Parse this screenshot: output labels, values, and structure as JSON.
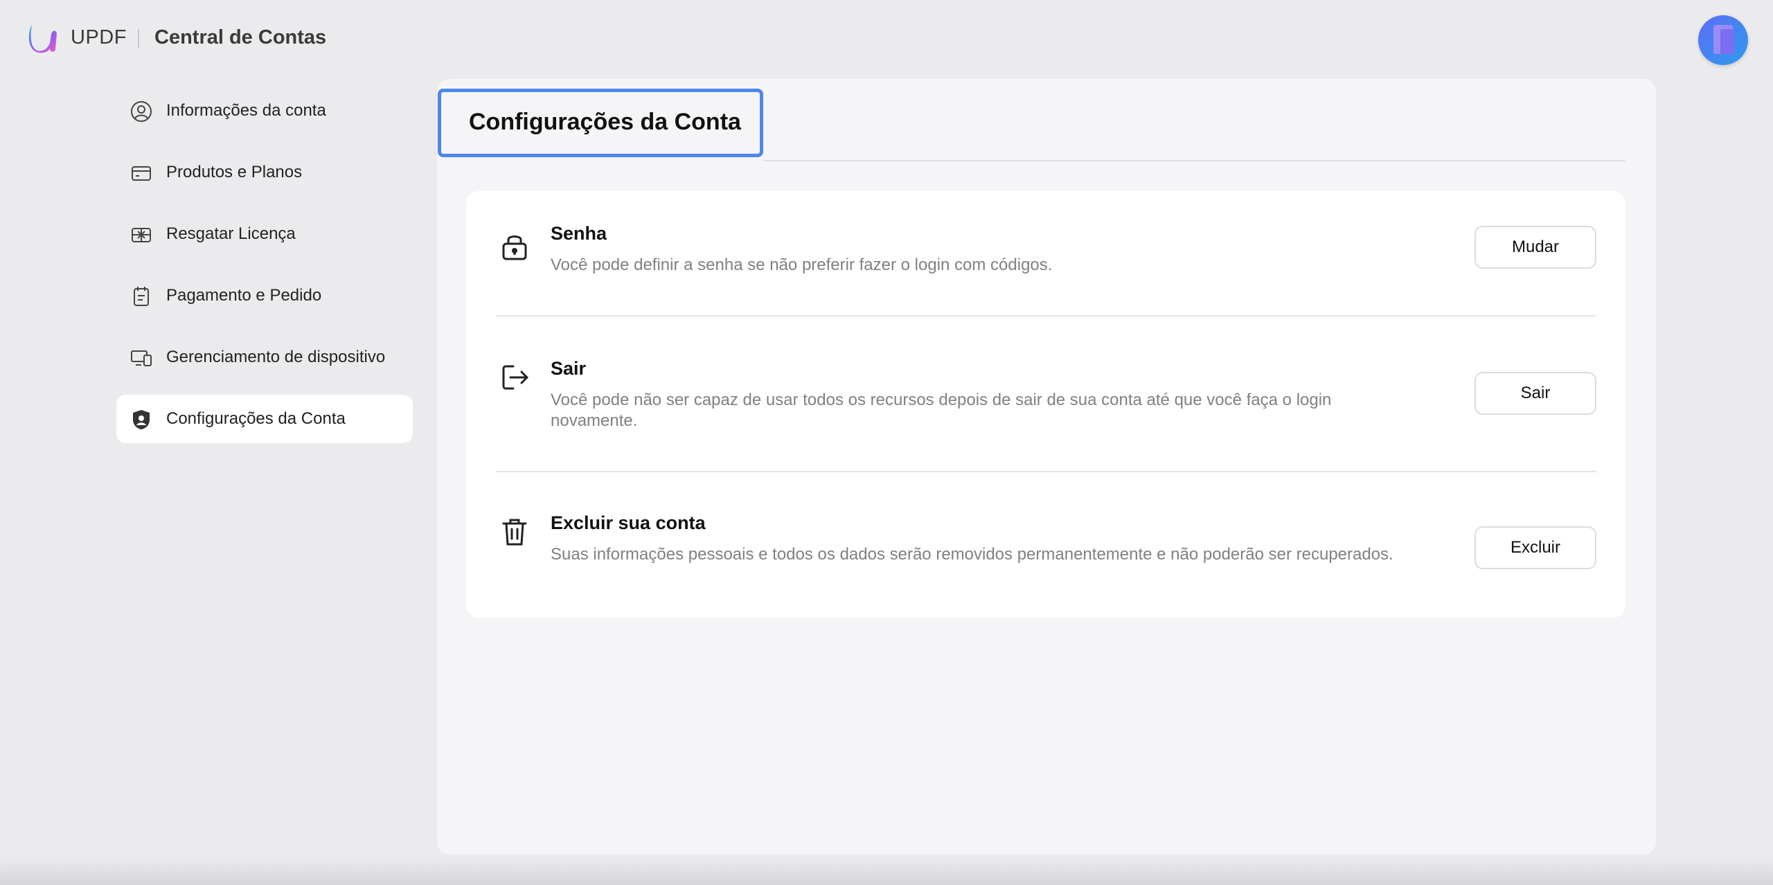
{
  "header": {
    "brand": "UPDF",
    "title": "Central de Contas",
    "avatar_icon": "user-avatar"
  },
  "sidebar": {
    "items": [
      {
        "label": "Informações da conta",
        "icon": "user-circle-icon",
        "active": false
      },
      {
        "label": "Produtos e Planos",
        "icon": "card-icon",
        "active": false
      },
      {
        "label": "Resgatar Licença",
        "icon": "gift-icon",
        "active": false
      },
      {
        "label": "Pagamento e Pedido",
        "icon": "clipboard-icon",
        "active": false
      },
      {
        "label": "Gerenciamento de dispositivo",
        "icon": "devices-icon",
        "active": false
      },
      {
        "label": "Configurações da Conta",
        "icon": "shield-user-icon",
        "active": true
      }
    ]
  },
  "main": {
    "tab_title": "Configurações da Conta",
    "settings": [
      {
        "icon": "lock-icon",
        "title": "Senha",
        "description": "Você pode definir a senha se não preferir fazer o login com códigos.",
        "button": "Mudar"
      },
      {
        "icon": "logout-icon",
        "title": "Sair",
        "description": "Você pode não ser capaz de usar todos os recursos depois de sair de sua conta até que você faça o login novamente.",
        "button": "Sair"
      },
      {
        "icon": "trash-icon",
        "title": "Excluir sua conta",
        "description": "Suas informações pessoais e todos os dados serão removidos permanentemente e não poderão ser recuperados.",
        "button": "Excluir"
      }
    ]
  },
  "colors": {
    "accent": "#4f86ec",
    "background": "#ebebed",
    "panel": "#f5f5f7",
    "muted_text": "#808085"
  }
}
